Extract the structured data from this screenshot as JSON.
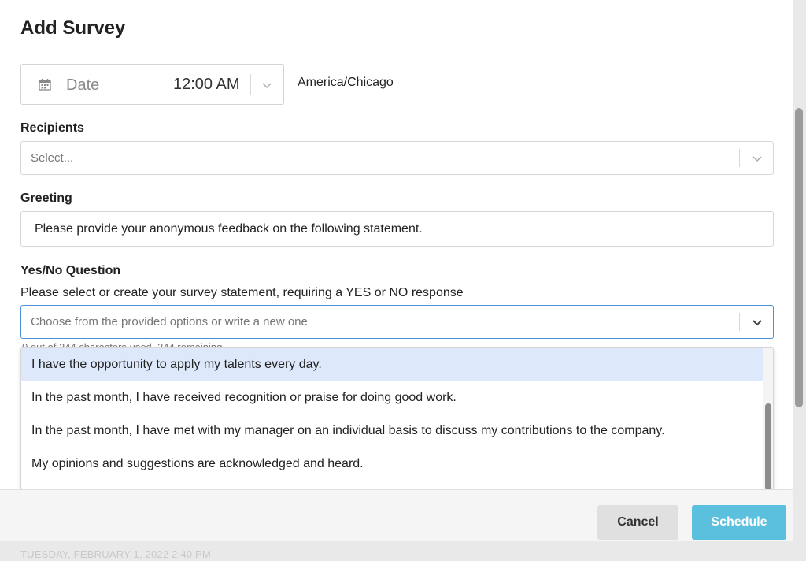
{
  "modal": {
    "title": "Add Survey"
  },
  "schedule": {
    "date_placeholder": "Date",
    "time_value": "12:00 AM",
    "timezone": "America/Chicago"
  },
  "recipients": {
    "label": "Recipients",
    "placeholder": "Select..."
  },
  "greeting": {
    "label": "Greeting",
    "value": "Please provide your anonymous feedback on the following statement."
  },
  "question": {
    "label": "Yes/No Question",
    "hint": "Please select or create your survey statement, requiring a YES or NO response",
    "placeholder": "Choose from the provided options or write a new one",
    "obscured_text": "0 out of 244 characters used, 244 remaining",
    "options": [
      "I have the opportunity to apply my talents every day.",
      "In the past month, I have received recognition or praise for doing good work.",
      "In the past month, I have met with my manager on an individual basis to discuss my contributions to the company.",
      "My opinions and suggestions are acknowledged and heard."
    ],
    "highlighted_index": 0
  },
  "footer": {
    "cancel_label": "Cancel",
    "schedule_label": "Schedule"
  },
  "background_page": {
    "timestamp": "TUESDAY, FEBRUARY 1, 2022 2:40 PM"
  },
  "colors": {
    "accent": "#5bc0de",
    "focus_border": "#4a90d9",
    "option_highlight": "#dde9fb"
  }
}
